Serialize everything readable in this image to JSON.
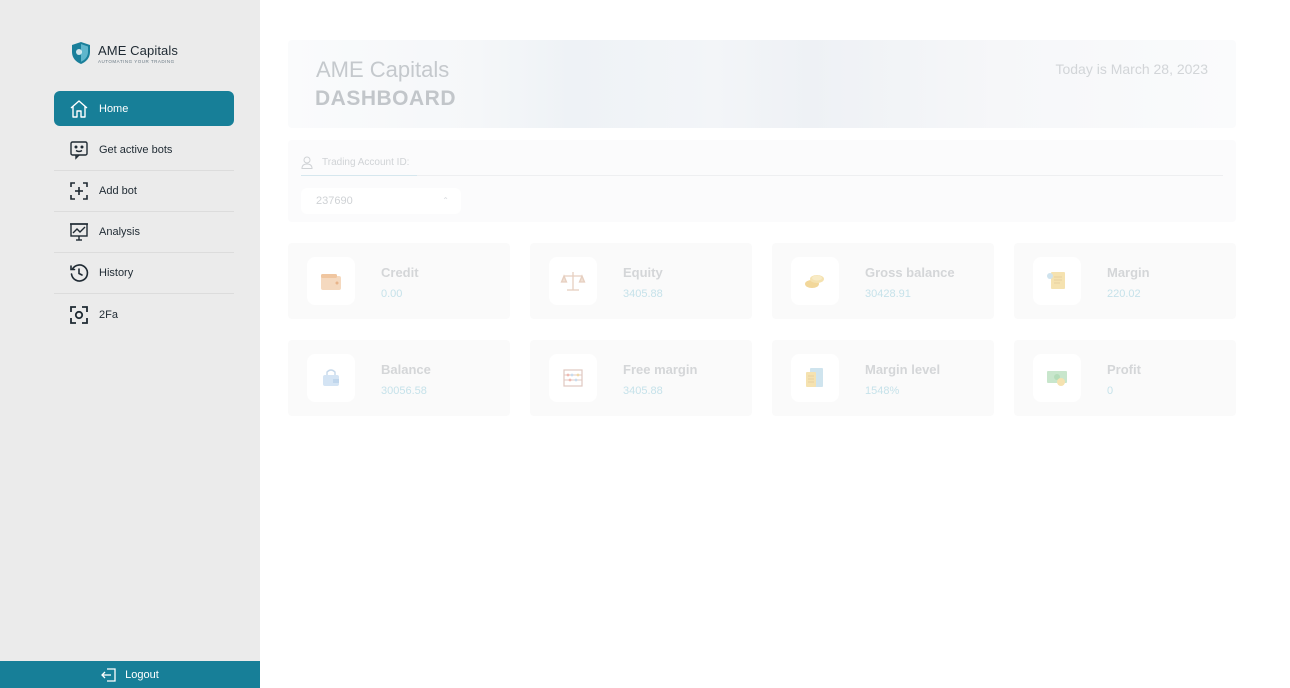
{
  "brand": {
    "name": "AME Capitals",
    "tagline": "AUTOMATING YOUR TRADING"
  },
  "sidebar": {
    "items": [
      {
        "label": "Home",
        "icon": "home-icon",
        "active": true
      },
      {
        "label": "Get active bots",
        "icon": "bot-face-icon",
        "active": false
      },
      {
        "label": "Add bot",
        "icon": "add-bot-icon",
        "active": false
      },
      {
        "label": "Analysis",
        "icon": "chart-board-icon",
        "active": false
      },
      {
        "label": "History",
        "icon": "history-icon",
        "active": false
      },
      {
        "label": "2Fa",
        "icon": "scan-icon",
        "active": false
      }
    ],
    "logout_label": "Logout"
  },
  "header": {
    "title": "AME Capitals",
    "subtitle": "DASHBOARD",
    "date_text": "Today is March 28, 2023"
  },
  "account": {
    "label": "Trading Account ID:",
    "selected": "237690"
  },
  "cards": [
    {
      "label": "Credit",
      "value": "0.00",
      "icon": "wallet-icon"
    },
    {
      "label": "Equity",
      "value": "3405.88",
      "icon": "scale-icon"
    },
    {
      "label": "Gross balance",
      "value": "30428.91",
      "icon": "coins-icon"
    },
    {
      "label": "Margin",
      "value": "220.02",
      "icon": "scroll-icon"
    },
    {
      "label": "Balance",
      "value": "30056.58",
      "icon": "bag-icon"
    },
    {
      "label": "Free margin",
      "value": "3405.88",
      "icon": "abacus-icon"
    },
    {
      "label": "Margin level",
      "value": "1548%",
      "icon": "calculator-icon"
    },
    {
      "label": "Profit",
      "value": "0",
      "icon": "money-icon"
    }
  ],
  "colors": {
    "accent": "#177f98",
    "sidebar_bg": "#ebebeb"
  }
}
